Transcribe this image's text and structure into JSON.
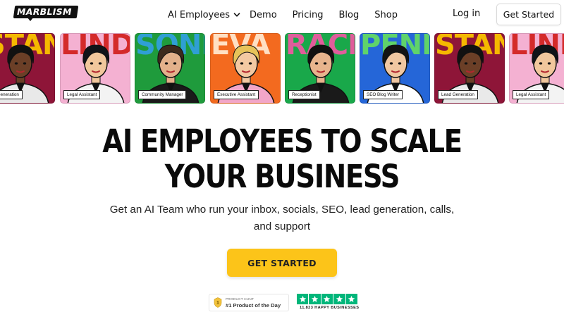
{
  "nav": {
    "logo_text": "MARBLISM",
    "links": [
      {
        "label": "AI Employees",
        "has_dropdown": true
      },
      {
        "label": "Demo"
      },
      {
        "label": "Pricing"
      },
      {
        "label": "Blog"
      },
      {
        "label": "Shop"
      }
    ],
    "login_label": "Log in",
    "get_started_label": "Get Started"
  },
  "cards": [
    {
      "name": "STAN",
      "role": "Lead Generation",
      "bg": "#8e1538",
      "name_color": "#f5b800",
      "skin": "#6b3f27",
      "hair": "#111111",
      "shirt": "#e9e9e9"
    },
    {
      "name": "LINDA",
      "role": "Legal Assistant",
      "bg": "#f4b1d2",
      "name_color": "#d42a2a",
      "skin": "#f1c79c",
      "hair": "#101418",
      "shirt": "#f3f3f3"
    },
    {
      "name": "SONNY",
      "role": "Community Manager",
      "bg": "#1f9b3c",
      "name_color": "#2f9fd4",
      "skin": "#e3b18b",
      "hair": "#3d2a1c",
      "shirt": "#1a1a1a"
    },
    {
      "name": "EVA",
      "role": "Executive Assistant",
      "bg": "#f36a1f",
      "name_color": "#ffe0c4",
      "skin": "#f3c9a2",
      "hair": "#e7c35a",
      "shirt": "#f2a6c8"
    },
    {
      "name": "RACHEL",
      "role": "Receptionist",
      "bg": "#19a84a",
      "name_color": "#e05d9b",
      "skin": "#e7b48d",
      "hair": "#111111",
      "shirt": "#1a1a1a"
    },
    {
      "name": "PENNY",
      "role": "SEO Blog Writer",
      "bg": "#2566d8",
      "name_color": "#5fd36a",
      "skin": "#f0c7a1",
      "hair": "#131313",
      "shirt": "#ffffff"
    },
    {
      "name": "STAN",
      "role": "Lead Generation",
      "bg": "#8e1538",
      "name_color": "#f5b800",
      "skin": "#6b3f27",
      "hair": "#111111",
      "shirt": "#e9e9e9"
    },
    {
      "name": "LINDA",
      "role": "Legal Assistant",
      "bg": "#f4b1d2",
      "name_color": "#d42a2a",
      "skin": "#f1c79c",
      "hair": "#101418",
      "shirt": "#f3f3f3"
    }
  ],
  "hero": {
    "headline_line1": "AI EMPLOYEES TO SCALE",
    "headline_line2": "YOUR BUSINESS",
    "subtitle": "Get an AI Team who run your inbox, socials, SEO, lead generation, calls, and support",
    "cta_label": "GET STARTED"
  },
  "badges": {
    "product_hunt_small": "PRODUCT HUNT",
    "product_hunt_main": "#1 Product of the Day",
    "trustpilot_text": "11,823 HAPPY BUSINESSES",
    "trustpilot_color": "#00b67a",
    "trustpilot_stars": 5
  },
  "colors": {
    "accent": "#fcc419",
    "text": "#111111"
  }
}
